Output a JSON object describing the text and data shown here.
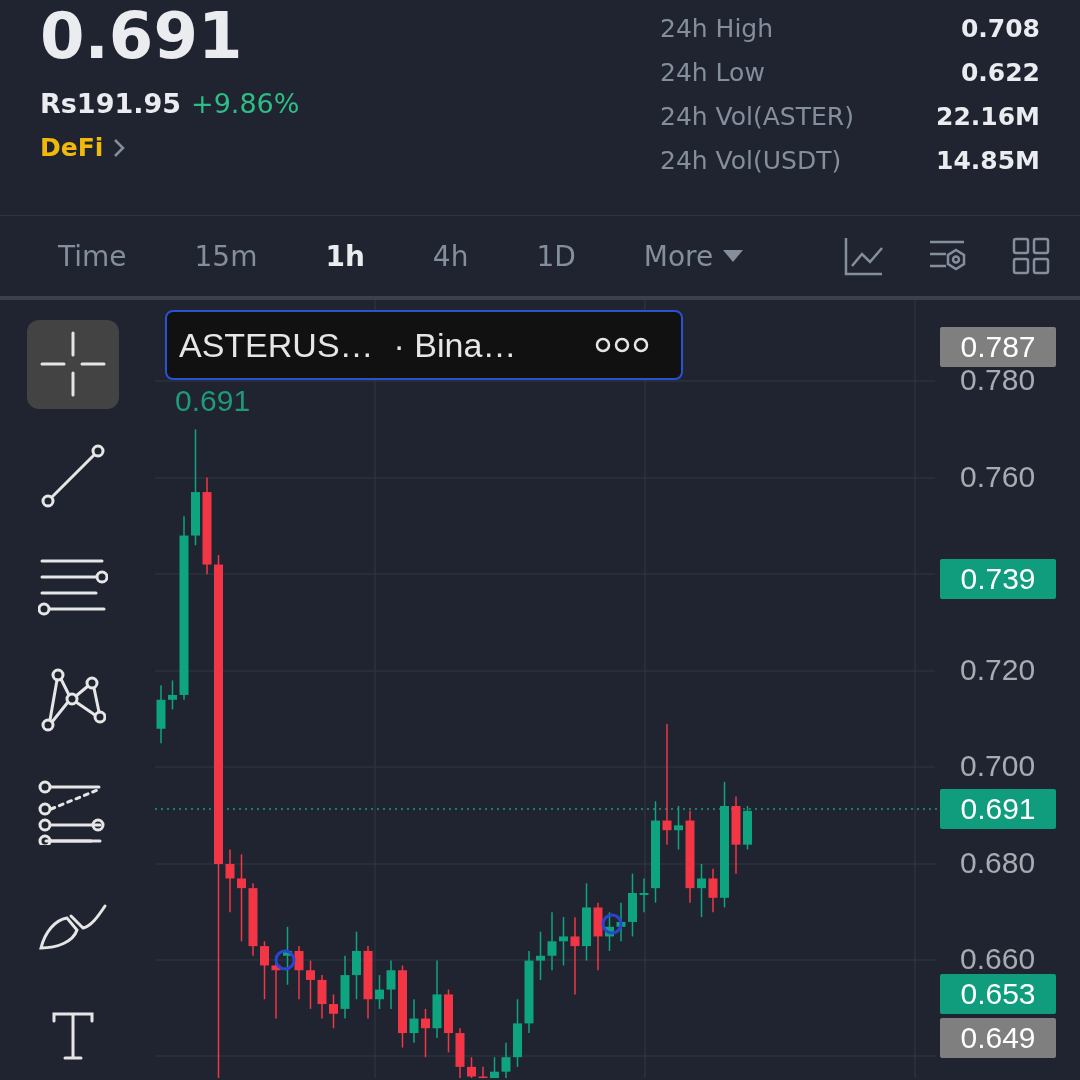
{
  "header": {
    "price": "0.691",
    "fiat_price": "Rs191.95",
    "change": "+9.86%",
    "tag": "DeFi"
  },
  "stats": [
    {
      "label": "24h High",
      "value": "0.708"
    },
    {
      "label": "24h Low",
      "value": "0.622"
    },
    {
      "label": "24h Vol(ASTER)",
      "value": "22.16M"
    },
    {
      "label": "24h Vol(USDT)",
      "value": "14.85M"
    }
  ],
  "intervals": [
    {
      "label": "Time",
      "selected": false
    },
    {
      "label": "15m",
      "selected": false
    },
    {
      "label": "1h",
      "selected": true
    },
    {
      "label": "4h",
      "selected": false
    },
    {
      "label": "1D",
      "selected": false
    }
  ],
  "more": "More",
  "tools": [
    {
      "kind": "crosshair",
      "selected": true
    },
    {
      "kind": "line",
      "selected": false
    },
    {
      "kind": "hlines",
      "selected": false
    },
    {
      "kind": "pattern",
      "selected": false
    },
    {
      "kind": "fib",
      "selected": false
    },
    {
      "kind": "brush",
      "selected": false
    },
    {
      "kind": "text",
      "selected": false
    }
  ],
  "chart": {
    "symbol": "ASTERUS…",
    "exchange": "· Bina…",
    "high_marker": "0.691",
    "axis_labels": [
      "0.780",
      "0.760",
      "0.720",
      "0.700",
      "0.680",
      "0.660"
    ],
    "price_tags": [
      {
        "value": "0.787",
        "color": "#7f7f7f"
      },
      {
        "value": "0.739",
        "color": "#0f9d7e"
      },
      {
        "value": "0.691",
        "color": "#0f9d7e"
      },
      {
        "value": "0.653",
        "color": "#0f9d7e"
      },
      {
        "value": "0.649",
        "color": "#7f7f7f"
      }
    ]
  }
}
